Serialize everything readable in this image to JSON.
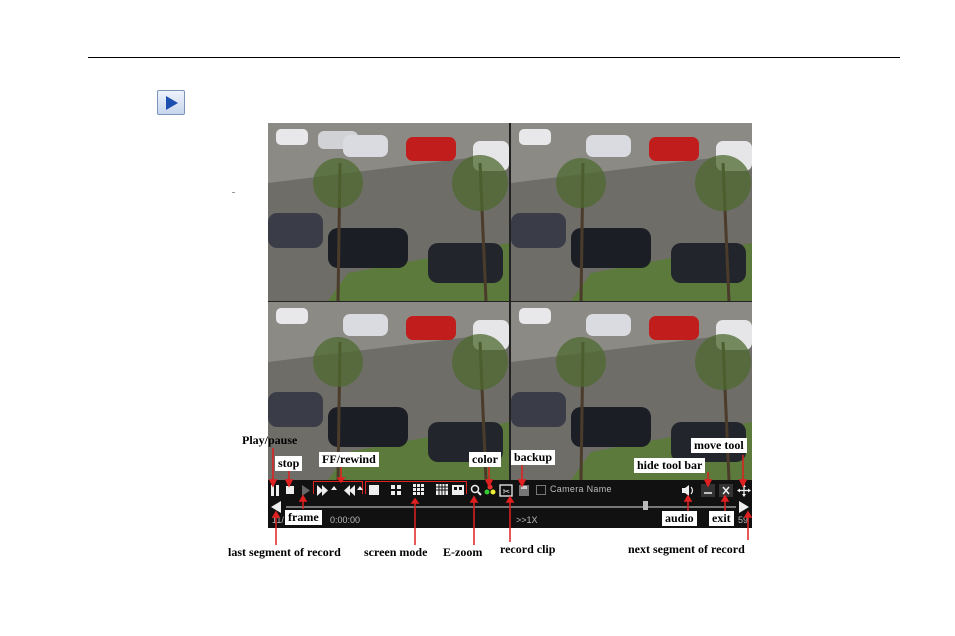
{
  "doc": {
    "play_icon": "play-triangle-icon"
  },
  "player": {
    "camera_name": "Camera Name",
    "time_start": "11/",
    "time_current": "0:00:00",
    "speed": ">>1X",
    "time_end": "59"
  },
  "callouts": {
    "play_pause": "Play/pause",
    "stop": "stop",
    "ff_rewind": "FF/rewind",
    "frame": "frame",
    "last_segment": "last segment of record",
    "screen_mode": "screen mode",
    "e_zoom": "E-zoom",
    "color": "color",
    "backup": "backup",
    "record_clip": "record clip",
    "hide_tool_bar": "hide tool bar",
    "move_tool": "move tool",
    "audio": "audio",
    "exit": "exit",
    "next_segment": "next segment of record"
  }
}
